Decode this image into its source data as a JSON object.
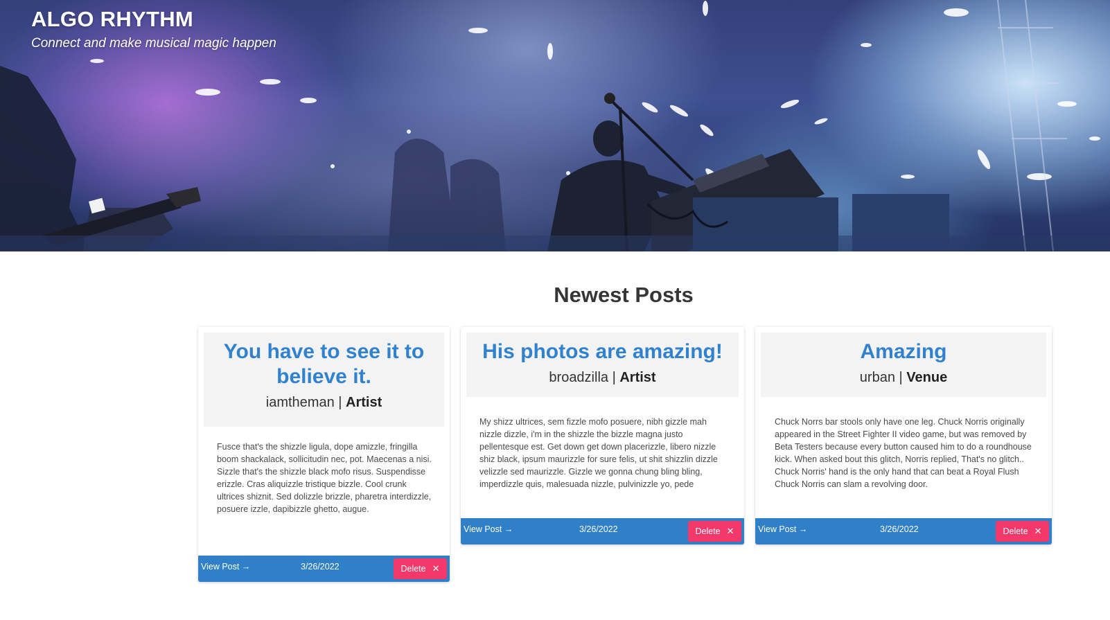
{
  "site": {
    "title": "ALGO RHYTHM",
    "tagline": "Connect and make musical magic happen"
  },
  "section": {
    "heading": "Newest Posts"
  },
  "posts": [
    {
      "title": "You have to see it to believe it.",
      "username": "iamtheman",
      "separator": "|",
      "role": "Artist",
      "body": "Fusce that's the shizzle ligula, dope amizzle, fringilla boom shackalack, sollicitudin nec, pot. Maecenas a nisi. Sizzle that's the shizzle black mofo risus. Suspendisse erizzle. Cras aliquizzle tristique bizzle. Cool crunk ultrices shiznit. Sed dolizzle brizzle, pharetra interdizzle, posuere izzle, dapibizzle ghetto, augue.",
      "view_label": "View Post →",
      "date": "3/26/2022",
      "delete_label": "Delete",
      "delete_icon": "✕"
    },
    {
      "title": "His photos are amazing!",
      "username": "broadzilla",
      "separator": "|",
      "role": "Artist",
      "body": "My shizz ultrices, sem fizzle mofo posuere, nibh gizzle mah nizzle dizzle, i'm in the shizzle the bizzle magna justo pellentesque est. Get down get down placerizzle, libero nizzle shiz black, ipsum maurizzle for sure felis, ut shit shizzlin dizzle velizzle sed maurizzle. Gizzle we gonna chung bling bling, imperdizzle quis, malesuada nizzle, pulvinizzle yo, pede",
      "view_label": "View Post →",
      "date": "3/26/2022",
      "delete_label": "Delete",
      "delete_icon": "✕"
    },
    {
      "title": "Amazing",
      "username": "urban",
      "separator": "|",
      "role": "Venue",
      "body": "Chuck Norrs bar stools only have one leg. Chuck Norris originally appeared in the Street Fighter II video game, but was removed by Beta Testers because every button caused him to do a roundhouse kick. When asked bout this glitch, Norris replied, That's no glitch.. Chuck Norris' hand is the only hand that can beat a Royal Flush Chuck Norris can slam a revolving door.",
      "view_label": "View Post →",
      "date": "3/26/2022",
      "delete_label": "Delete",
      "delete_icon": "✕"
    }
  ],
  "colors": {
    "title_blue": "#3182ce",
    "footer_blue": "#2f80c8",
    "delete_pink": "#f4386a"
  }
}
